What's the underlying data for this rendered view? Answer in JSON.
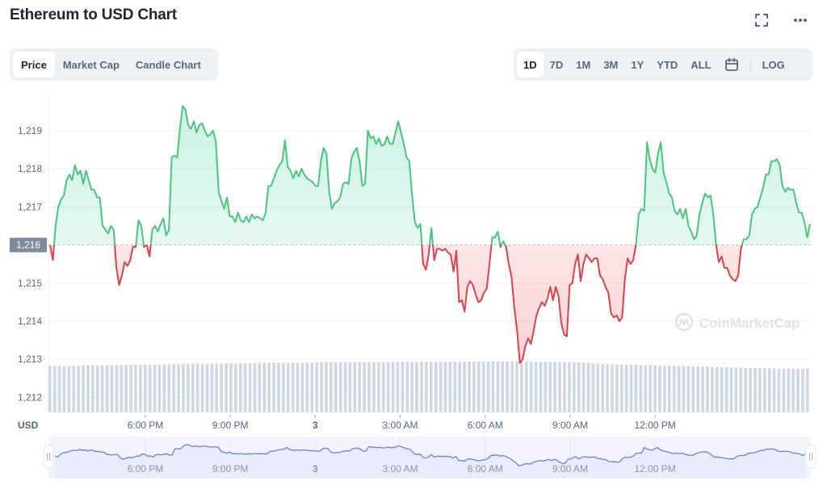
{
  "header": {
    "title": "Ethereum to USD Chart",
    "fullscreen_icon": "fullscreen-icon",
    "more_icon": "more-horizontal-icon"
  },
  "chart_tabs": [
    {
      "label": "Price",
      "active": true
    },
    {
      "label": "Market Cap",
      "active": false
    },
    {
      "label": "Candle Chart",
      "active": false
    }
  ],
  "range_tabs": [
    {
      "label": "1D",
      "active": true
    },
    {
      "label": "7D",
      "active": false
    },
    {
      "label": "1M",
      "active": false
    },
    {
      "label": "3M",
      "active": false
    },
    {
      "label": "1Y",
      "active": false
    },
    {
      "label": "YTD",
      "active": false
    },
    {
      "label": "ALL",
      "active": false
    }
  ],
  "calendar_icon": "calendar-icon",
  "log_label": "LOG",
  "watermark": "CoinMarketCap",
  "colors": {
    "up": "#16c784",
    "up_line": "#4bc480",
    "down": "#ea3943",
    "down_line": "#d9434c",
    "volume": "#cfd6e4",
    "navigator_line": "#6b7ff0",
    "navigator_fill": "#e8ebfd",
    "baseline_badge": "#808a9d"
  },
  "chart_data": {
    "type": "line",
    "title": "Ethereum to USD Chart",
    "ylabel": "USD",
    "xlabel": "",
    "ylim": [
      1211.6,
      1219.95
    ],
    "yticks": [
      "1,212",
      "1,213",
      "1,214",
      "1,215",
      "1,216",
      "1,217",
      "1,218",
      "1,219"
    ],
    "baseline": 1216,
    "baseline_label": "1,216",
    "grid": true,
    "x_range_hours": [
      -3.42,
      23.5
    ],
    "xticks": [
      {
        "hour": 0,
        "label": "6:00 PM",
        "bold": false
      },
      {
        "hour": 3,
        "label": "9:00 PM",
        "bold": false
      },
      {
        "hour": 6,
        "label": "3",
        "bold": true
      },
      {
        "hour": 9,
        "label": "3:00 AM",
        "bold": false
      },
      {
        "hour": 12,
        "label": "6:00 AM",
        "bold": false
      },
      {
        "hour": 15,
        "label": "9:00 AM",
        "bold": false
      },
      {
        "hour": 18,
        "label": "12:00 PM",
        "bold": false
      }
    ],
    "series": [
      {
        "name": "Price",
        "values": [
          1216.0,
          1215.6,
          1216.5,
          1217.0,
          1217.2,
          1217.3,
          1217.7,
          1217.85,
          1217.7,
          1218.1,
          1217.85,
          1217.95,
          1217.6,
          1217.95,
          1217.7,
          1217.45,
          1217.45,
          1217.25,
          1217.25,
          1216.5,
          1216.4,
          1216.3,
          1216.5,
          1216.4,
          1215.4,
          1214.95,
          1215.2,
          1215.55,
          1215.45,
          1215.6,
          1215.95,
          1215.95,
          1216.65,
          1216.5,
          1215.95,
          1216.0,
          1215.7,
          1216.4,
          1216.5,
          1216.35,
          1216.55,
          1216.7,
          1216.25,
          1216.4,
          1218.3,
          1218.35,
          1218.3,
          1219.05,
          1219.65,
          1219.55,
          1219.15,
          1219.05,
          1219.25,
          1218.95,
          1219.15,
          1219.2,
          1219.0,
          1218.85,
          1218.9,
          1219.0,
          1218.7,
          1217.4,
          1217.15,
          1216.95,
          1217.25,
          1216.75,
          1216.75,
          1216.6,
          1216.85,
          1216.65,
          1216.6,
          1216.75,
          1216.6,
          1216.8,
          1216.7,
          1216.75,
          1216.7,
          1216.65,
          1216.85,
          1217.55,
          1217.55,
          1217.75,
          1217.95,
          1218.1,
          1218.2,
          1218.75,
          1218.05,
          1217.95,
          1217.75,
          1217.95,
          1217.8,
          1218.0,
          1217.85,
          1217.75,
          1217.7,
          1217.65,
          1217.55,
          1217.55,
          1218.2,
          1218.55,
          1218.4,
          1217.4,
          1216.95,
          1217.1,
          1217.15,
          1217.25,
          1217.6,
          1217.65,
          1217.6,
          1218.25,
          1218.45,
          1218.55,
          1218.2,
          1217.55,
          1217.6,
          1219.0,
          1218.8,
          1218.85,
          1218.65,
          1218.8,
          1218.6,
          1218.65,
          1218.85,
          1218.65,
          1218.65,
          1218.95,
          1219.25,
          1218.95,
          1218.65,
          1218.3,
          1218.2,
          1217.3,
          1216.6,
          1216.45,
          1216.55,
          1215.5,
          1215.35,
          1215.75,
          1216.45,
          1215.6,
          1215.9,
          1215.9,
          1215.85,
          1215.9,
          1215.8,
          1215.75,
          1215.3,
          1215.85,
          1214.5,
          1214.55,
          1214.25,
          1214.9,
          1215.05,
          1214.95,
          1214.7,
          1214.5,
          1214.55,
          1214.75,
          1214.85,
          1215.5,
          1216.2,
          1216.2,
          1216.35,
          1215.95,
          1216.1,
          1215.95,
          1215.5,
          1215.15,
          1214.35,
          1213.75,
          1212.9,
          1213.0,
          1213.35,
          1213.55,
          1213.4,
          1213.75,
          1214.15,
          1214.35,
          1214.5,
          1214.4,
          1214.6,
          1214.9,
          1214.55,
          1214.9,
          1214.65,
          1213.95,
          1213.65,
          1213.6,
          1214.95,
          1215.0,
          1215.5,
          1215.75,
          1215.05,
          1215.5,
          1215.75,
          1215.65,
          1215.55,
          1215.65,
          1215.65,
          1215.2,
          1215.1,
          1214.9,
          1214.75,
          1214.2,
          1214.1,
          1214.15,
          1214.0,
          1214.1,
          1215.1,
          1215.65,
          1215.5,
          1215.6,
          1216.0,
          1216.8,
          1216.95,
          1216.9,
          1218.7,
          1218.25,
          1218.0,
          1217.9,
          1218.4,
          1218.7,
          1217.9,
          1217.65,
          1217.35,
          1217.25,
          1216.9,
          1216.8,
          1216.95,
          1216.7,
          1216.95,
          1216.5,
          1216.35,
          1216.15,
          1216.25,
          1216.8,
          1217.1,
          1217.35,
          1217.25,
          1217.3,
          1216.8,
          1216.0,
          1215.55,
          1215.7,
          1215.4,
          1215.4,
          1215.2,
          1215.1,
          1215.05,
          1215.2,
          1215.9,
          1216.15,
          1216.15,
          1216.25,
          1216.8,
          1216.95,
          1217.0,
          1217.25,
          1217.5,
          1217.85,
          1217.85,
          1218.2,
          1218.2,
          1218.25,
          1218.1,
          1217.55,
          1217.4,
          1217.5,
          1217.45,
          1217.45,
          1217.1,
          1216.85,
          1216.85,
          1216.6,
          1216.2,
          1216.55
        ]
      },
      {
        "name": "Volume",
        "values_relative": [
          0.76,
          0.76,
          0.77,
          0.77,
          0.78,
          0.78,
          0.79,
          0.8,
          0.8,
          0.81,
          0.81,
          0.82,
          0.82,
          0.82,
          0.83,
          0.83,
          0.83,
          0.83,
          0.84,
          0.84,
          0.84,
          0.84,
          0.85,
          0.85,
          0.85,
          0.84,
          0.84,
          0.83,
          0.81,
          0.79,
          0.78,
          0.77,
          0.76,
          0.75,
          0.74,
          0.73,
          0.72,
          0.71,
          0.7,
          0.7
        ]
      }
    ]
  },
  "navigator": {
    "labels": [
      "6:00 PM",
      "9:00 PM",
      "3",
      "3:00 AM",
      "6:00 AM",
      "9:00 AM",
      "12:00 PM"
    ],
    "left_handle_icon": "drag-handle-icon",
    "right_handle_icon": "drag-handle-icon"
  }
}
